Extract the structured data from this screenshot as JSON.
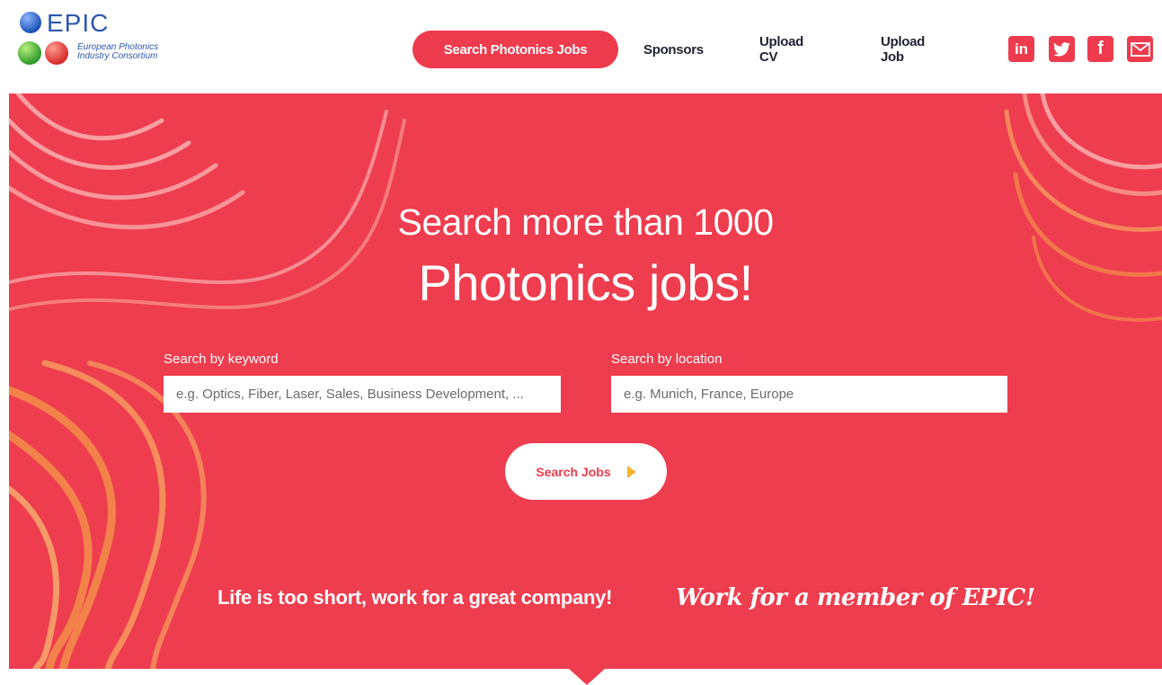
{
  "logo": {
    "brand": "EPIC",
    "subtitle_line1": "European Photonics",
    "subtitle_line2": "Industry Consortium"
  },
  "nav": {
    "search_jobs": "Search Photonics Jobs",
    "sponsors": "Sponsors",
    "upload_cv": "Upload CV",
    "upload_job": "Upload Job"
  },
  "social": {
    "linkedin_glyph": "in",
    "facebook_glyph": "f",
    "icons": [
      "linkedin-icon",
      "twitter-icon",
      "facebook-icon",
      "mail-icon"
    ]
  },
  "hero": {
    "headline_line1": "Search more than 1000",
    "headline_line2": "Photonics jobs!",
    "keyword_label": "Search by keyword",
    "keyword_placeholder": "e.g. Optics, Fiber, Laser, Sales, Business Development, ...",
    "location_label": "Search by location",
    "location_placeholder": "e.g. Munich, France, Europe",
    "search_button": "Search Jobs",
    "tagline": "Life is too short, work for a great company!",
    "tagline_script": "Work for a member of EPIC!"
  },
  "colors": {
    "brand_red": "#ee3b4d",
    "logo_blue": "#2c58ad",
    "arrow_yellow": "#f2b630",
    "nav_text": "#1e2333"
  }
}
